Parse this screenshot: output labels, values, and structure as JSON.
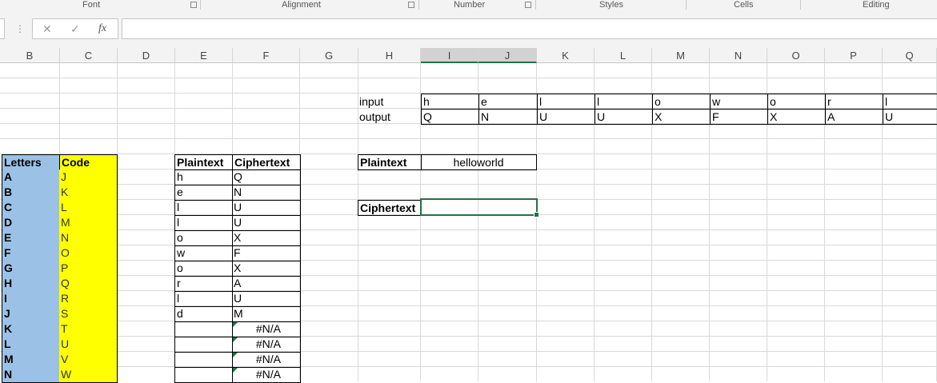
{
  "ribbon": {
    "groups": [
      "Font",
      "Alignment",
      "Number",
      "Styles",
      "Cells",
      "Editing"
    ]
  },
  "formula_bar": {
    "cancel_icon": "✕",
    "enter_icon": "✓",
    "fx_label": "fx",
    "value": ""
  },
  "columns": [
    "B",
    "C",
    "D",
    "E",
    "F",
    "G",
    "H",
    "I",
    "J",
    "K",
    "L",
    "M",
    "N",
    "O",
    "P",
    "Q"
  ],
  "io_table": {
    "input_label": "input",
    "output_label": "output",
    "inputs": [
      "h",
      "e",
      "l",
      "l",
      "o",
      "w",
      "o",
      "r",
      "l"
    ],
    "outputs": [
      "Q",
      "N",
      "U",
      "U",
      "X",
      "F",
      "X",
      "A",
      "U"
    ]
  },
  "letters_table": {
    "header_letters": "Letters",
    "header_code": "Code",
    "rows": [
      [
        "A",
        "J"
      ],
      [
        "B",
        "K"
      ],
      [
        "C",
        "L"
      ],
      [
        "D",
        "M"
      ],
      [
        "E",
        "N"
      ],
      [
        "F",
        "O"
      ],
      [
        "G",
        "P"
      ],
      [
        "H",
        "Q"
      ],
      [
        "I",
        "R"
      ],
      [
        "J",
        "S"
      ],
      [
        "K",
        "T"
      ],
      [
        "L",
        "U"
      ],
      [
        "M",
        "V"
      ],
      [
        "N",
        "W"
      ]
    ]
  },
  "cipher_table": {
    "header_plain": "Plaintext",
    "header_cipher": "Ciphertext",
    "rows": [
      [
        "h",
        "Q"
      ],
      [
        "e",
        "N"
      ],
      [
        "l",
        "U"
      ],
      [
        "l",
        "U"
      ],
      [
        "o",
        "X"
      ],
      [
        "w",
        "F"
      ],
      [
        "o",
        "X"
      ],
      [
        "r",
        "A"
      ],
      [
        "l",
        "U"
      ],
      [
        "d",
        "M"
      ],
      [
        "",
        "#N/A"
      ],
      [
        "",
        "#N/A"
      ],
      [
        "",
        "#N/A"
      ],
      [
        "",
        "#N/A"
      ]
    ]
  },
  "plaintext_box": {
    "label": "Plaintext",
    "value": "helloworld"
  },
  "ciphertext_box": {
    "label": "Ciphertext",
    "value": ""
  },
  "colors": {
    "accent": "#217346",
    "blue": "#9bc2e6",
    "yellow": "#ffff00"
  }
}
